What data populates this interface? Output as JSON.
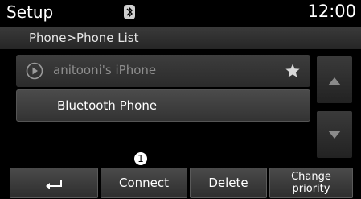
{
  "header": {
    "title": "Setup",
    "bluetooth_icon": "bluetooth-icon",
    "clock": "12:00"
  },
  "breadcrumb": {
    "text": "Phone>Phone List"
  },
  "phone_list": {
    "items": [
      {
        "label": "anitooni's iPhone",
        "icon": "play-icon",
        "favorite_icon": "star-icon",
        "state": "dimmed"
      },
      {
        "label": "Bluetooth Phone",
        "state": "selected"
      }
    ]
  },
  "scroll": {
    "up_icon": "triangle-up-icon",
    "down_icon": "triangle-down-icon"
  },
  "callout": {
    "number": "1"
  },
  "bottom_bar": {
    "back_icon": "return-arrow-icon",
    "connect_label": "Connect",
    "delete_label": "Delete",
    "change_priority_line1": "Change",
    "change_priority_line2": "priority"
  }
}
